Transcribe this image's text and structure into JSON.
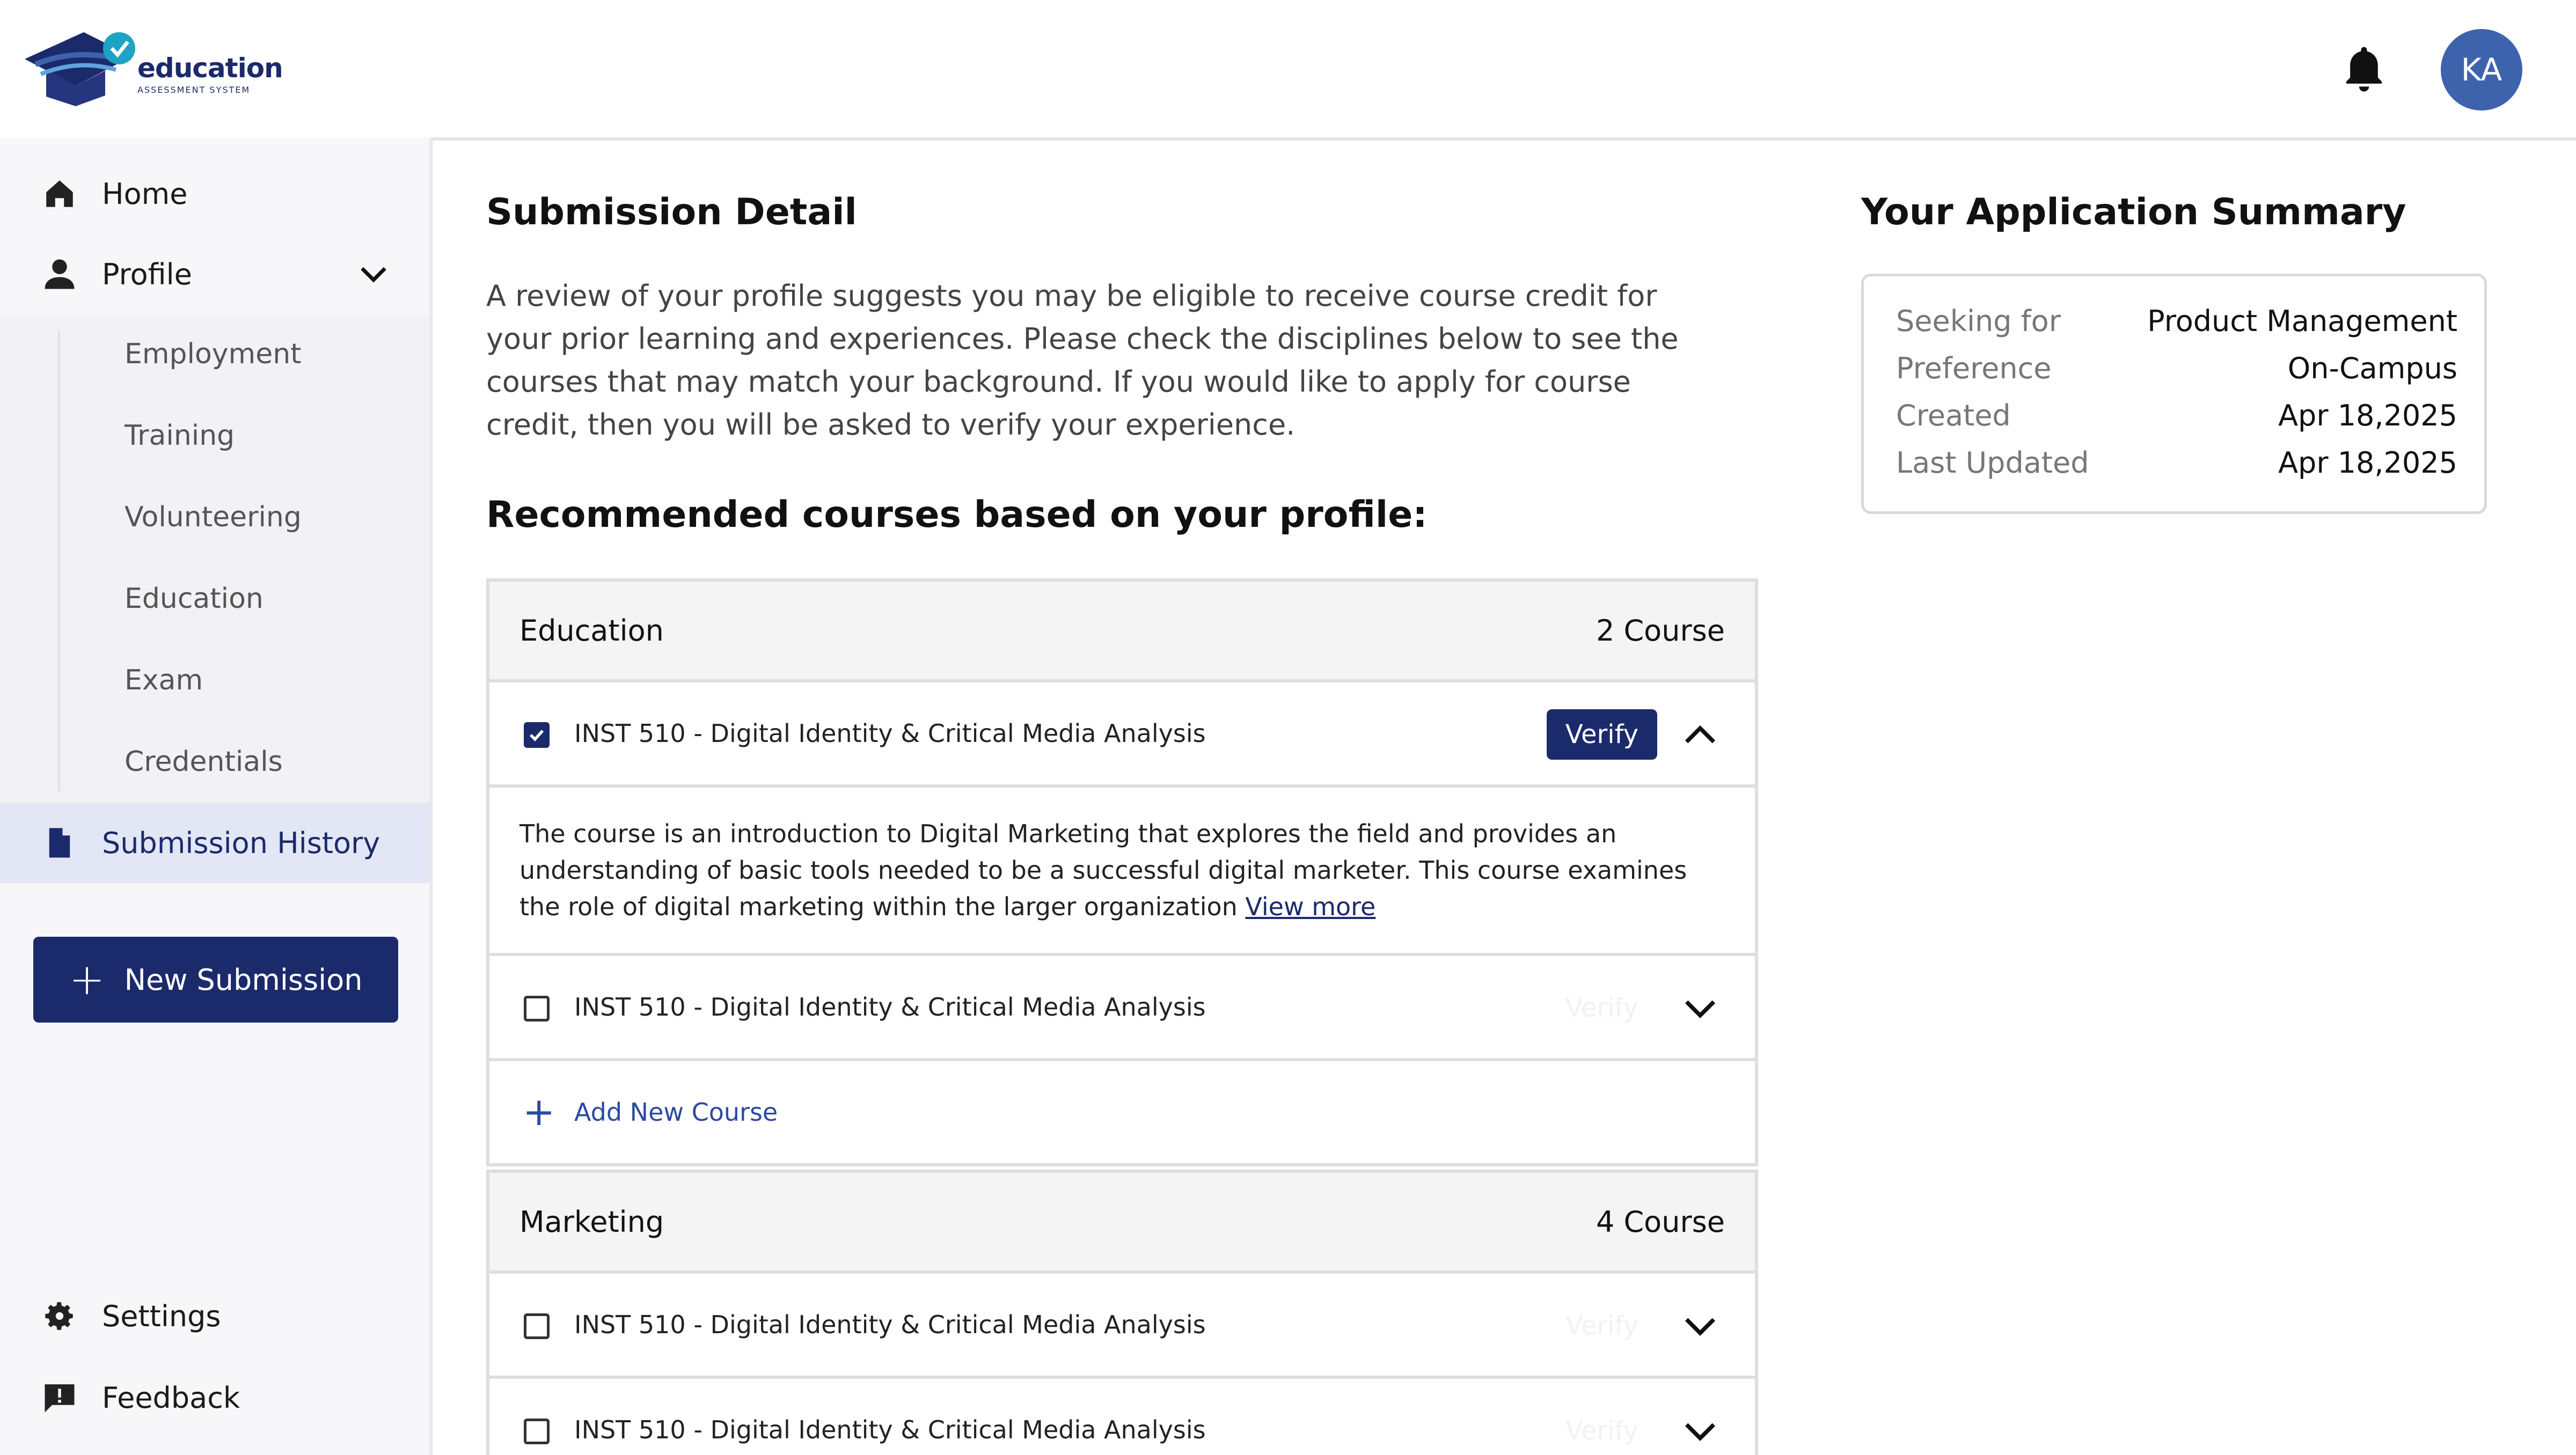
{
  "brand": {
    "name": "education",
    "subtitle": "ASSESSMENT SYSTEM",
    "colors": {
      "primary": "#1b2a6b",
      "accent": "#3e63ad",
      "check": "#1fa3c4"
    }
  },
  "header": {
    "avatar_initials": "KA",
    "bell_icon": "bell-icon"
  },
  "sidebar": {
    "home": "Home",
    "profile": "Profile",
    "profile_subitems": [
      "Employment",
      "Training",
      "Volunteering",
      "Education",
      "Exam",
      "Credentials"
    ],
    "submission_history": "Submission History",
    "new_submission": "New Submission",
    "settings": "Settings",
    "feedback": "Feedback"
  },
  "main": {
    "title": "Submission Detail",
    "description": "A review of your profile suggests you may be eligible to receive course credit for your prior learning and experiences. Please check the disciplines below to see the courses that may match your background. If you would like to apply for course credit, then you will be asked to verify your experience.",
    "recommended_title": "Recommended courses based on your profile:",
    "verify_label": "Verify",
    "add_course_label": "Add New Course",
    "groups": [
      {
        "name": "Education",
        "count": "2 Course",
        "courses": [
          {
            "title": "INST 510 - Digital Identity & Critical Media Analysis",
            "checked": true,
            "expanded": true,
            "detail": "The course is an introduction to Digital Marketing that explores the field and provides an understanding of basic tools needed to be a successful digital marketer. This course examines the role of digital marketing within the larger organization",
            "view_more": "View more"
          },
          {
            "title": "INST 510 - Digital Identity & Critical Media Analysis",
            "checked": false,
            "expanded": false
          }
        ]
      },
      {
        "name": "Marketing",
        "count": "4 Course",
        "courses": [
          {
            "title": "INST 510 - Digital Identity & Critical Media Analysis",
            "checked": false,
            "expanded": false
          },
          {
            "title": "INST 510 - Digital Identity & Critical Media Analysis",
            "checked": false,
            "expanded": false
          }
        ]
      }
    ]
  },
  "summary": {
    "title": "Your Application Summary",
    "rows": [
      {
        "label": "Seeking for",
        "value": "Product Management"
      },
      {
        "label": "Preference",
        "value": "On-Campus"
      },
      {
        "label": "Created",
        "value": "Apr 18,2025"
      },
      {
        "label": "Last Updated",
        "value": "Apr 18,2025"
      }
    ]
  }
}
